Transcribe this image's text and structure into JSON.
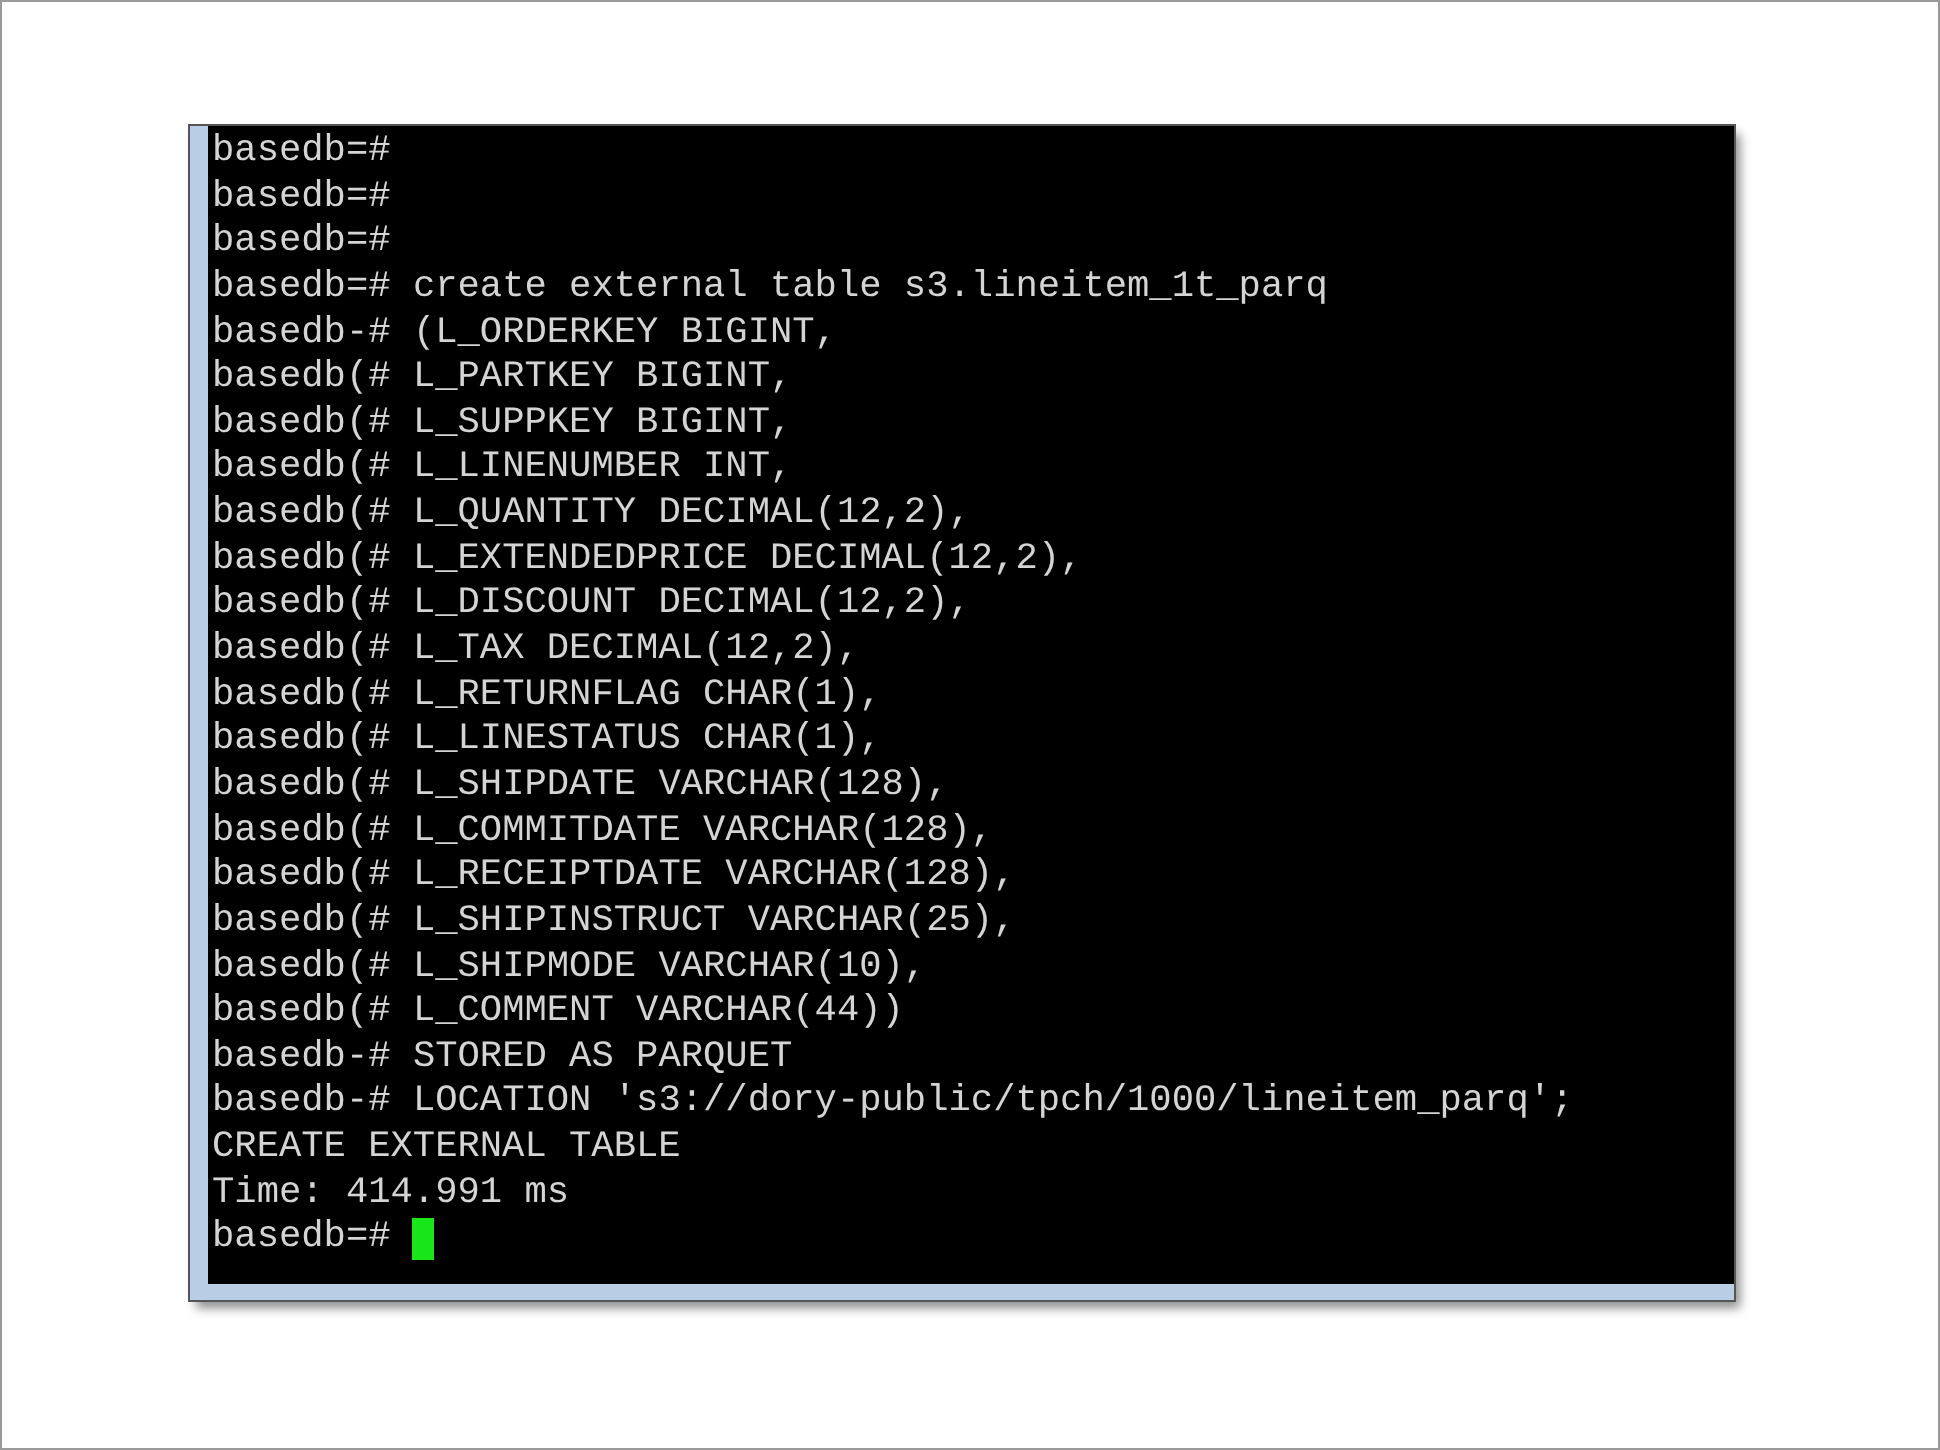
{
  "terminal": {
    "lines": [
      {
        "kind": "input",
        "prompt": "basedb=#"
      },
      {
        "kind": "input",
        "prompt": "basedb=#"
      },
      {
        "kind": "input",
        "prompt": "basedb=#"
      },
      {
        "kind": "input",
        "prompt": "basedb=#",
        "command": "create external table s3.lineitem_1t_parq"
      },
      {
        "kind": "input",
        "prompt": "basedb-#",
        "command": "(L_ORDERKEY BIGINT,"
      },
      {
        "kind": "input",
        "prompt": "basedb(#",
        "command": "L_PARTKEY BIGINT,"
      },
      {
        "kind": "input",
        "prompt": "basedb(#",
        "command": "L_SUPPKEY BIGINT,"
      },
      {
        "kind": "input",
        "prompt": "basedb(#",
        "command": "L_LINENUMBER INT,"
      },
      {
        "kind": "input",
        "prompt": "basedb(#",
        "command": "L_QUANTITY DECIMAL(12,2),"
      },
      {
        "kind": "input",
        "prompt": "basedb(#",
        "command": "L_EXTENDEDPRICE DECIMAL(12,2),"
      },
      {
        "kind": "input",
        "prompt": "basedb(#",
        "command": "L_DISCOUNT DECIMAL(12,2),"
      },
      {
        "kind": "input",
        "prompt": "basedb(#",
        "command": "L_TAX DECIMAL(12,2),"
      },
      {
        "kind": "input",
        "prompt": "basedb(#",
        "command": "L_RETURNFLAG CHAR(1),"
      },
      {
        "kind": "input",
        "prompt": "basedb(#",
        "command": "L_LINESTATUS CHAR(1),"
      },
      {
        "kind": "input",
        "prompt": "basedb(#",
        "command": "L_SHIPDATE VARCHAR(128),"
      },
      {
        "kind": "input",
        "prompt": "basedb(#",
        "command": "L_COMMITDATE VARCHAR(128),"
      },
      {
        "kind": "input",
        "prompt": "basedb(#",
        "command": "L_RECEIPTDATE VARCHAR(128),"
      },
      {
        "kind": "input",
        "prompt": "basedb(#",
        "command": "L_SHIPINSTRUCT VARCHAR(25),"
      },
      {
        "kind": "input",
        "prompt": "basedb(#",
        "command": "L_SHIPMODE VARCHAR(10),"
      },
      {
        "kind": "input",
        "prompt": "basedb(#",
        "command": "L_COMMENT VARCHAR(44))"
      },
      {
        "kind": "input",
        "prompt": "basedb-#",
        "command": "STORED AS PARQUET"
      },
      {
        "kind": "input",
        "prompt": "basedb-#",
        "command": "LOCATION 's3://dory-public/tpch/1000/lineitem_parq';"
      },
      {
        "kind": "output",
        "text": "CREATE EXTERNAL TABLE"
      },
      {
        "kind": "output",
        "text": "Time: 414.991 ms"
      },
      {
        "kind": "input",
        "prompt": "basedb=#"
      }
    ],
    "cursor_visible": true
  }
}
